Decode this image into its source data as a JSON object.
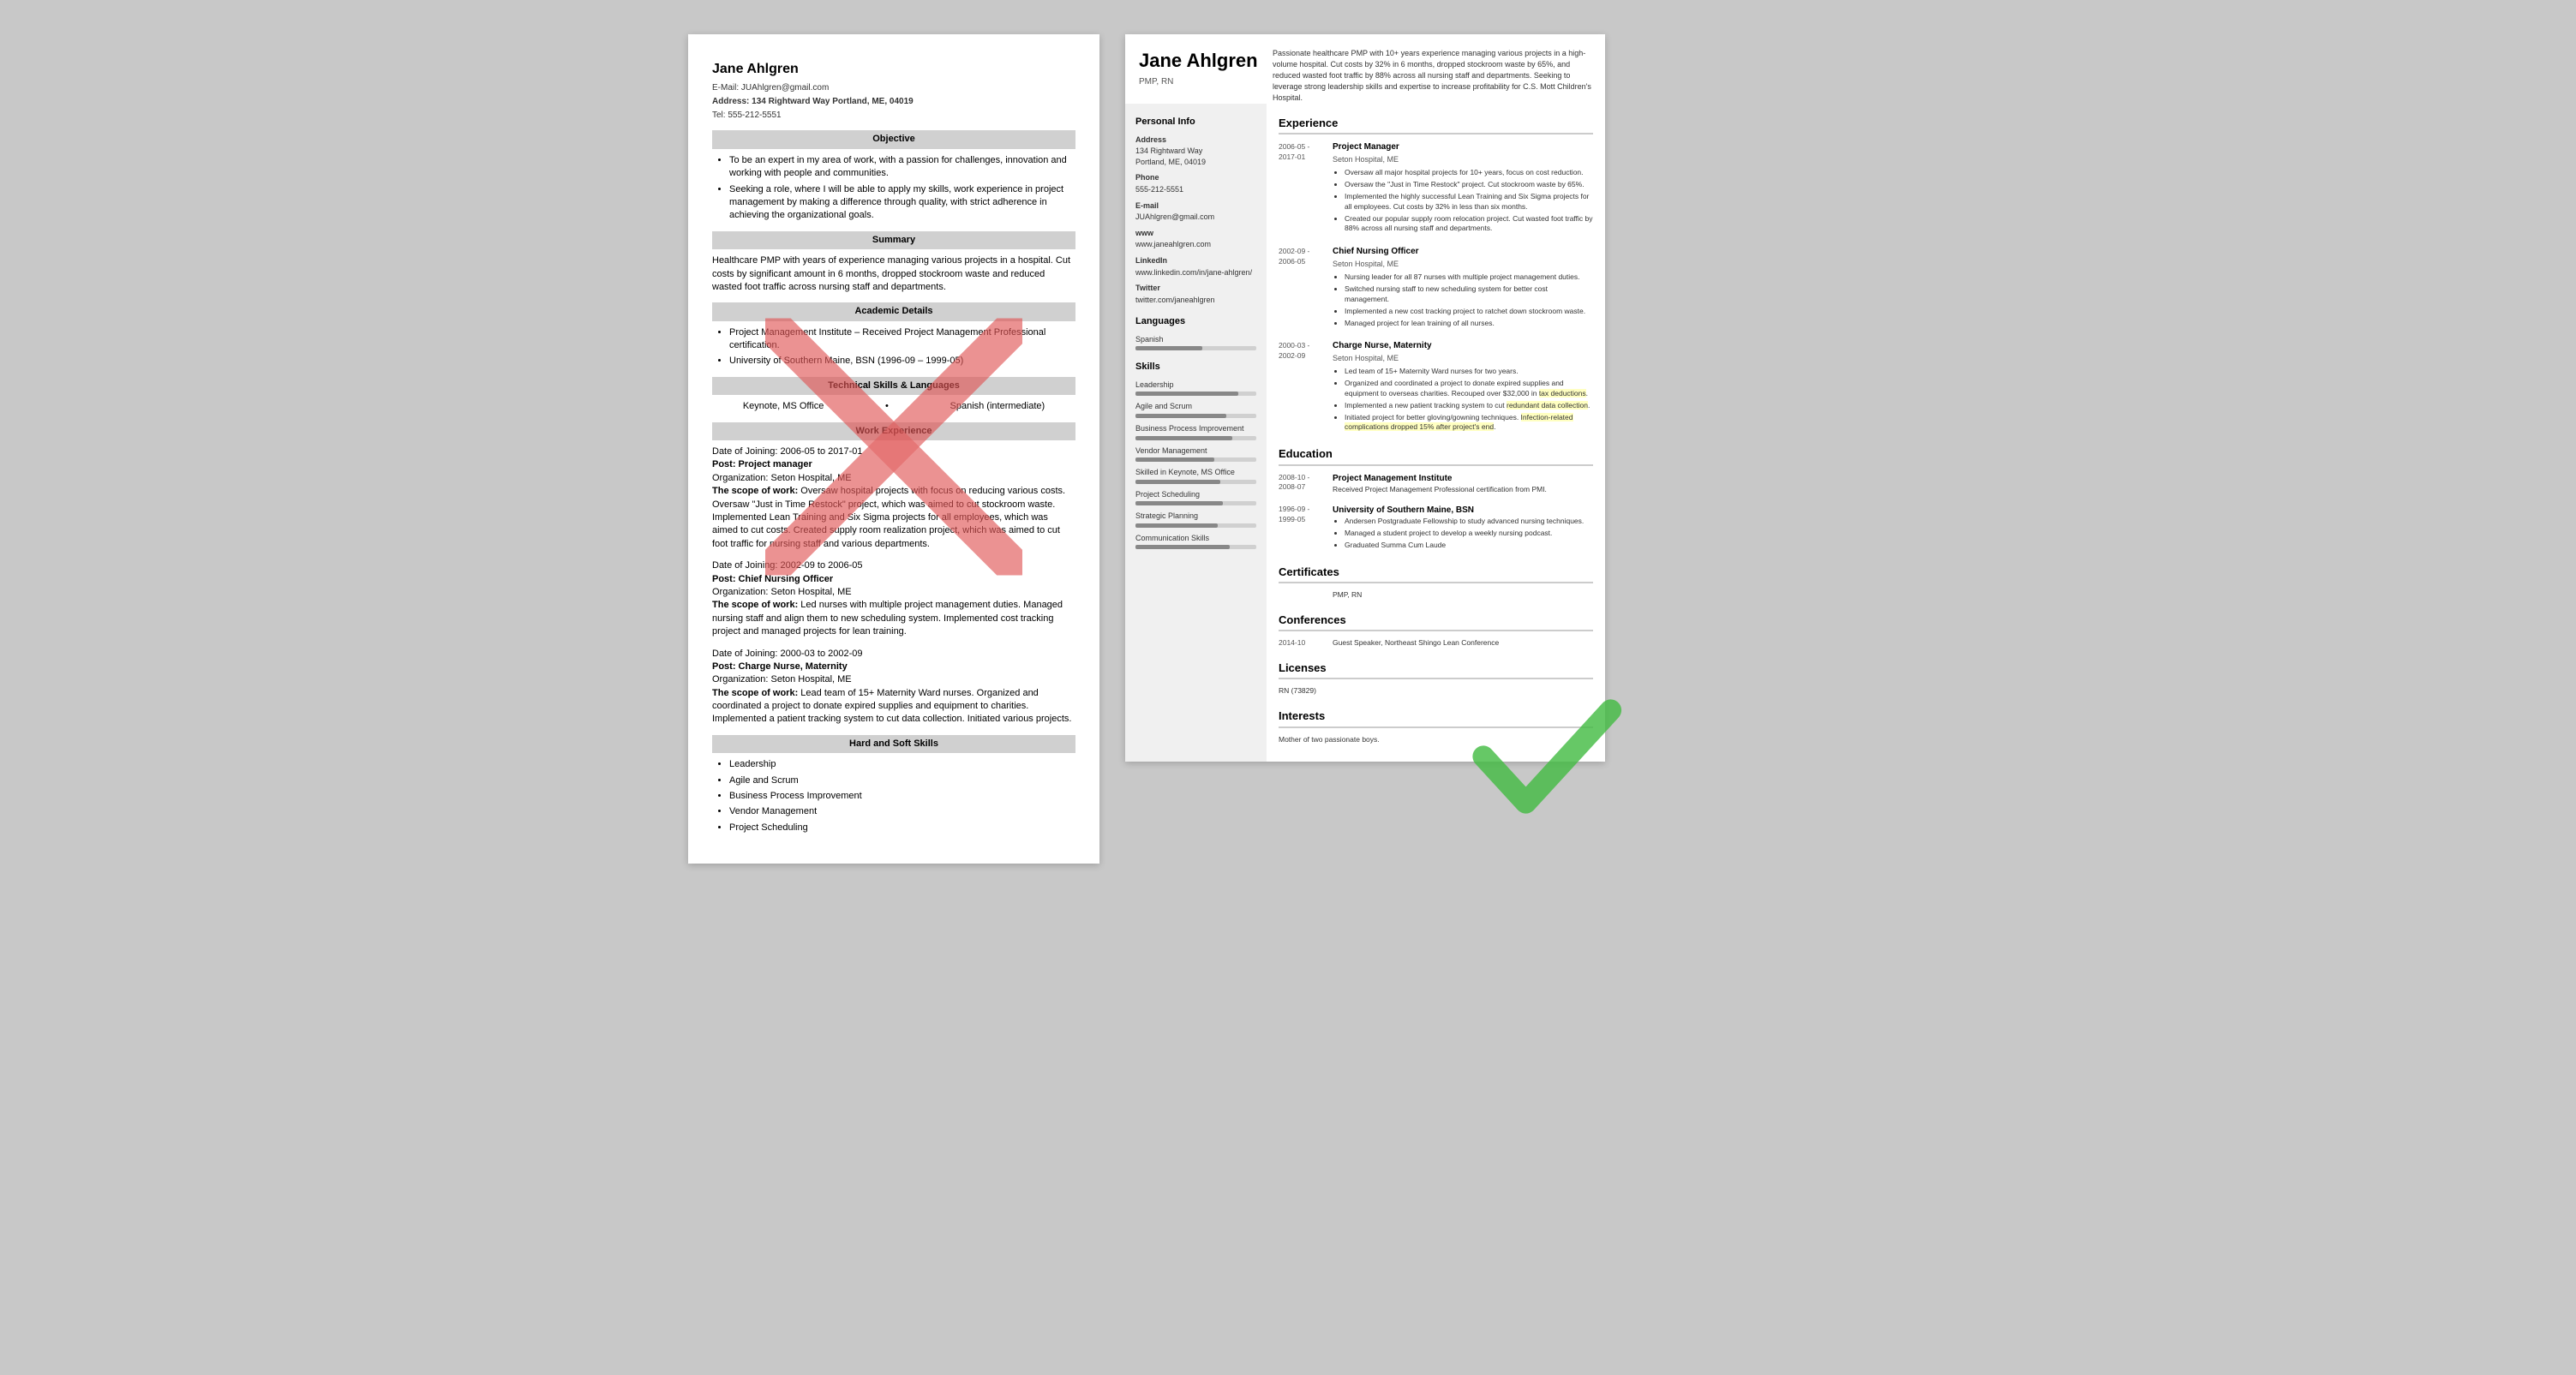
{
  "left_resume": {
    "name": "Jane Ahlgren",
    "email": "E-Mail: JUAhlgren@gmail.com",
    "address_label": "Address:",
    "address": "134 Rightward Way Portland, ME, 04019",
    "tel": "Tel: 555-212-5551",
    "sections": {
      "objective": {
        "title": "Objective",
        "bullets": [
          "To be an expert in my area of work, with a passion for challenges, innovation and working with people and communities.",
          "Seeking a role, where I will be able to apply my skills, work experience in project management by making a difference through quality, with strict adherence in achieving the organizational goals."
        ]
      },
      "summary": {
        "title": "Summary",
        "text": "Healthcare PMP with years of experience managing various projects in a hospital. Cut costs by significant amount in 6 months, dropped stockroom waste and reduced wasted foot traffic across nursing staff and departments."
      },
      "academic": {
        "title": "Academic Details",
        "bullets": [
          "Project Management Institute – Received Project Management Professional certification.",
          "University of Southern Maine, BSN (1996-09 – 1999-05)"
        ]
      },
      "technical_skills": {
        "title": "Technical Skills & Languages",
        "col1": "Keynote, MS Office",
        "col2": "Spanish (intermediate)"
      },
      "work_experience": {
        "title": "Work Experience",
        "entries": [
          {
            "date": "Date of Joining: 2006-05 to 2017-01",
            "post": "Post: Project manager",
            "org": "Organization: Seton Hospital, ME",
            "scope_label": "The scope of work:",
            "scope": " Oversaw hospital projects with focus on reducing various costs. Oversaw \"Just in Time Restock\" project, which was aimed to cut stockroom waste. Implemented Lean Training and Six Sigma projects for all employees, which was aimed to cut costs. Created supply room realization project, which was aimed to cut foot traffic for nursing staff and various departments."
          },
          {
            "date": "Date of Joining: 2002-09 to 2006-05",
            "post": "Post: Chief Nursing Officer",
            "org": "Organization: Seton Hospital, ME",
            "scope_label": "The scope of work:",
            "scope": " Led nurses with multiple project management duties. Managed nursing staff and align them to new scheduling system. Implemented cost tracking project and managed projects for lean training."
          },
          {
            "date": "Date of Joining: 2000-03 to 2002-09",
            "post": "Post: Charge Nurse, Maternity",
            "org": "Organization: Seton Hospital, ME",
            "scope_label": "The scope of work:",
            "scope": " Lead team of 15+ Maternity Ward nurses. Organized and coordinated a project to donate expired supplies and equipment to charities. Implemented a patient tracking system to cut data collection. Initiated various projects."
          }
        ]
      },
      "hard_soft_skills": {
        "title": "Hard and Soft Skills",
        "bullets": [
          "Leadership",
          "Agile and Scrum",
          "Business Process Improvement",
          "Vendor Management",
          "Project Scheduling"
        ]
      }
    }
  },
  "right_resume": {
    "name": "Jane Ahlgren",
    "title": "PMP, RN",
    "intro": "Passionate healthcare PMP with 10+ years experience managing various projects in a high-volume hospital. Cut costs by 32% in 6 months, dropped stockroom waste by 65%, and reduced wasted foot traffic by 88% across all nursing staff and departments. Seeking to leverage strong leadership skills and expertise to increase profitability for C.S. Mott Children's Hospital.",
    "sidebar": {
      "personal_info": {
        "title": "Personal Info",
        "fields": [
          {
            "label": "Address",
            "value": "134 Rightward Way\nPortland, ME, 04019"
          },
          {
            "label": "Phone",
            "value": "555-212-5551"
          },
          {
            "label": "E-mail",
            "value": "JUAhlgren@gmail.com"
          },
          {
            "label": "www",
            "value": "www.janeahlgren.com"
          },
          {
            "label": "LinkedIn",
            "value": "www.linkedin.com/in/jane-ahlgren/"
          },
          {
            "label": "Twitter",
            "value": "twitter.com/janeahlgren"
          }
        ]
      },
      "languages": {
        "title": "Languages",
        "items": [
          {
            "name": "Spanish",
            "level": 55
          }
        ]
      },
      "skills": {
        "title": "Skills",
        "items": [
          {
            "name": "Leadership",
            "level": 85
          },
          {
            "name": "Agile and Scrum",
            "level": 75
          },
          {
            "name": "Business Process Improvement",
            "level": 80
          },
          {
            "name": "Vendor Management",
            "level": 65
          },
          {
            "name": "Skilled in Keynote, MS Office",
            "level": 70
          },
          {
            "name": "Project Scheduling",
            "level": 72
          },
          {
            "name": "Strategic Planning",
            "level": 68
          },
          {
            "name": "Communication Skills",
            "level": 78
          }
        ]
      }
    },
    "main": {
      "experience": {
        "title": "Experience",
        "entries": [
          {
            "date": "2006-05 -\n2017-01",
            "title": "Project Manager",
            "org": "Seton Hospital, ME",
            "bullets": [
              "Oversaw all major hospital projects for 10+ years, focus on cost reduction.",
              "Oversaw the \"Just in Time Restock\" project. Cut stockroom waste by 65%.",
              "Implemented the highly successful Lean Training and Six Sigma projects for all employees. Cut costs by 32% in less than six months.",
              "Created our popular supply room relocation project. Cut wasted foot traffic by 88% across all nursing staff and departments."
            ]
          },
          {
            "date": "2002-09 -\n2006-05",
            "title": "Chief Nursing Officer",
            "org": "Seton Hospital, ME",
            "bullets": [
              "Nursing leader for all 87 nurses with multiple project management duties.",
              "Switched nursing staff to new scheduling system for better cost management.",
              "Implemented a new cost tracking project to ratchet down stockroom waste.",
              "Managed project for lean training of all nurses."
            ]
          },
          {
            "date": "2000-03 -\n2002-09",
            "title": "Charge Nurse, Maternity",
            "org": "Seton Hospital, ME",
            "bullets": [
              "Led team of 15+ Maternity Ward nurses for two years.",
              "Organized and coordinated a project to donate expired supplies and equipment to overseas charities. Recouped over $32,000 in tax deductions.",
              "Implemented a new patient tracking system to cut redundant data collection.",
              "Initiated project for better gloving/gowning techniques. Infection-related complications dropped 15% after project's end."
            ]
          }
        ]
      },
      "education": {
        "title": "Education",
        "entries": [
          {
            "date": "2008-10 -\n2008-07",
            "school": "Project Management Institute",
            "detail": "Received Project Management Professional certification from PMI."
          },
          {
            "date": "1996-09 -\n1999-05",
            "school": "University of Southern Maine, BSN",
            "bullets": [
              "Andersen Postgraduate Fellowship to study advanced nursing techniques.",
              "Managed a student project to develop a weekly nursing podcast.",
              "Graduated Summa Cum Laude"
            ]
          }
        ]
      },
      "certificates": {
        "title": "Certificates",
        "entries": [
          {
            "date": "",
            "value": "PMP, RN"
          }
        ]
      },
      "conferences": {
        "title": "Conferences",
        "entries": [
          {
            "date": "2014-10",
            "value": "Guest Speaker, Northeast Shingo Lean Conference"
          }
        ]
      },
      "licenses": {
        "title": "Licenses",
        "entries": [
          {
            "date": "",
            "value": "RN (73829)"
          }
        ]
      },
      "interests": {
        "title": "Interests",
        "entries": [
          {
            "date": "",
            "value": "Mother of two passionate boys."
          }
        ]
      }
    }
  }
}
